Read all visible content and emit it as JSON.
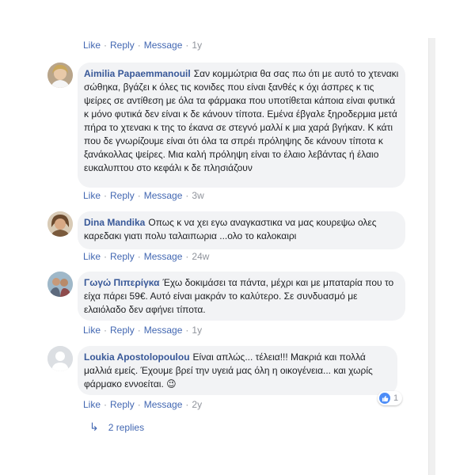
{
  "top_actions": {
    "like": "Like",
    "reply": "Reply",
    "message": "Message",
    "time": "1y"
  },
  "comments": [
    {
      "author": "Aimilia Papaemmanouil",
      "text": "Σαν κομμώτρια θα σας πω ότι με αυτό το χτενακι σώθηκα, βγάζει κ όλες τις κονιδες που είναι ξανθές κ όχι άσπρες κ τις ψείρες σε αντίθεση με όλα τα φάρμακα που υποτίθεται κάποια είναι φυτικά κ μόνο φυτικά δεν είναι κ δε κάνουν τίποτα. Εμένα έβγαλε ξηροδερμια μετά πήρα το χτενακι κ της το έκανα σε στεγνό μαλλί κ μια χαρά βγήκαν. Κ κάτι που δε γνωρίζουμε είναι ότι όλα τα σπρέι πρόληψης δε κάνουν τίποτα κ ξανάκολλας ψείρες. Μια καλή πρόληψη είναι το έλαιο λεβάντας ή έλαιο ευκαλυπτου στο κεφάλι κ δε πλησιάζουν",
      "like": "Like",
      "reply": "Reply",
      "message": "Message",
      "time": "3w"
    },
    {
      "author": "Dina Mandika",
      "text": "Οπως κ να χει εγω αναγκαστικα να μας κουρεψω ολες καρεδακι γιατι πολυ ταλαιπωρια ...ολο το καλοκαιρι",
      "like": "Like",
      "reply": "Reply",
      "message": "Message",
      "time": "24w"
    },
    {
      "author": "Γωγώ Πιπερίγκα",
      "text": "Έχω δοκιμάσει τα πάντα, μέχρι και με μπαταρία που το είχα πάρει 59€. Αυτό είναι μακράν το καλύτερο. Σε συνδυασμό με ελαιόλαδο δεν αφήνει τίποτα.",
      "like": "Like",
      "reply": "Reply",
      "message": "Message",
      "time": "1y"
    },
    {
      "author": "Loukia Apostolopoulou",
      "text": "Είναι απλώς... τέλεια!!! Μακριά και πολλά μαλλιά εμείς. Έχουμε βρεί την υγειά μας όλη η οικογένεια... και χωρίς φάρμακο εννοείται.",
      "emoji": "😉",
      "reaction_count": "1",
      "like": "Like",
      "reply": "Reply",
      "message": "Message",
      "time": "2y"
    }
  ],
  "replies_link": "2 replies",
  "colors": {
    "link": "#4267b2",
    "name": "#385898",
    "bubble": "#f2f3f5",
    "meta": "#90949c",
    "like_blue": "#4c8cf7"
  }
}
